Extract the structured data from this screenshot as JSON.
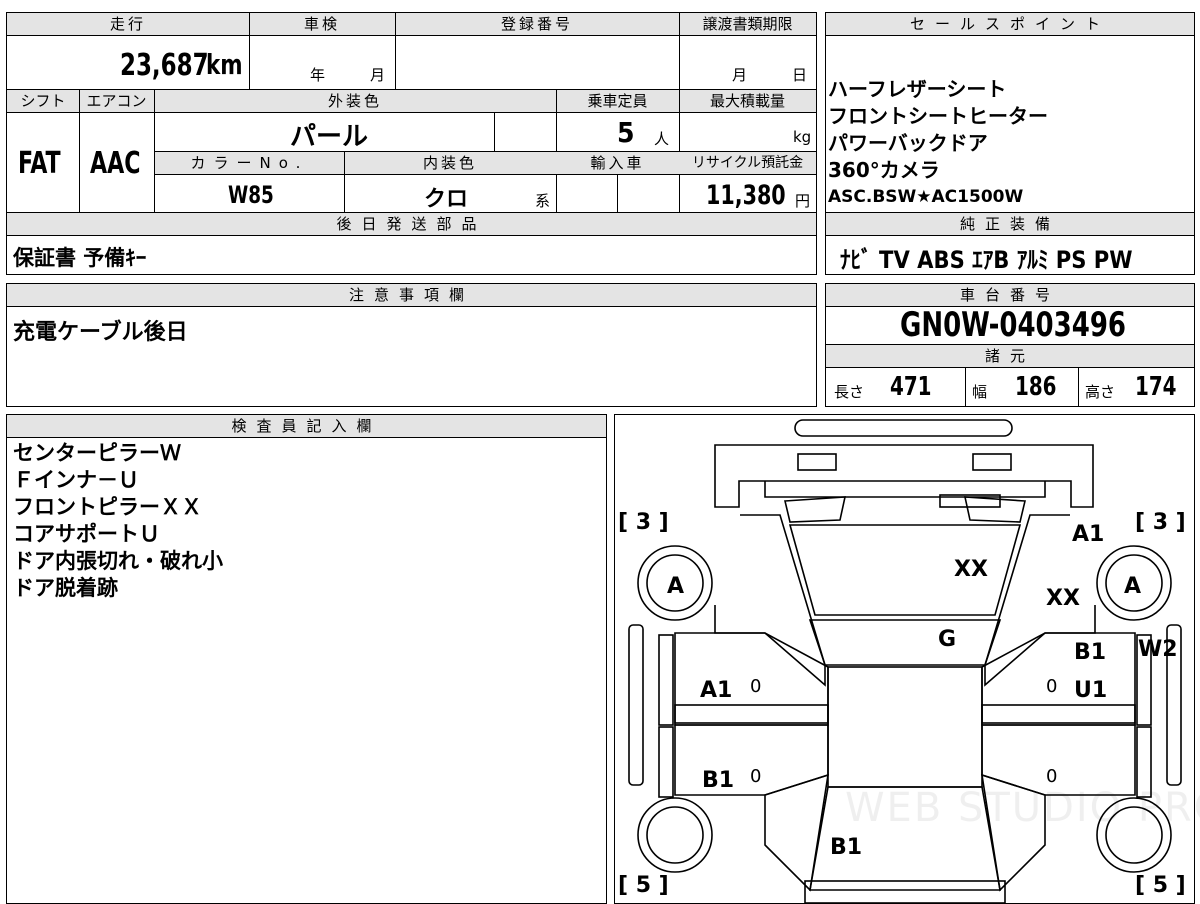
{
  "top": {
    "mileage_label": "走行",
    "mileage_value": "23,687",
    "mileage_unit": "km",
    "inspection_label": "車検",
    "inspection_year_unit": "年",
    "inspection_month_unit": "月",
    "registration_label": "登録番号",
    "transfer_label": "譲渡書類期限",
    "transfer_month_unit": "月",
    "transfer_day_unit": "日",
    "sales_points_label": "セールスポイント"
  },
  "specs": {
    "shift_label": "シフト",
    "shift_value": "FAT",
    "ac_label": "エアコン",
    "ac_value": "AAC",
    "exterior_color_label": "外装色",
    "exterior_color_value": "パール",
    "capacity_label": "乗車定員",
    "capacity_value": "5",
    "capacity_unit": "人",
    "max_load_label": "最大積載量",
    "max_load_unit": "kg",
    "color_no_label": "カラーNo.",
    "color_no_value": "W85",
    "interior_color_label": "内装色",
    "interior_color_value": "クロ",
    "interior_color_suffix": "系",
    "import_label": "輸入車",
    "recycle_label": "リサイクル預託金",
    "recycle_value": "11,380",
    "recycle_unit": "円"
  },
  "later_parts": {
    "label": "後日発送部品",
    "value": "保証書 予備ｷｰ"
  },
  "sales_points": {
    "items": [
      "ハーフレザーシート",
      "フロントシートヒーター",
      "パワーバックドア",
      "360°カメラ",
      "ASC.BSW★AC1500W"
    ]
  },
  "genuine_equipment": {
    "label": "純正装備",
    "value": "ﾅﾋﾞ TV ABS ｴｱB ｱﾙﾐ PS PW"
  },
  "notes": {
    "label": "注意事項欄",
    "value": "充電ケーブル後日"
  },
  "chassis": {
    "label": "車台番号",
    "value": "GN0W-0403496",
    "dims_label": "諸元",
    "length_label": "長さ",
    "length_value": "471",
    "width_label": "幅",
    "width_value": "186",
    "height_label": "高さ",
    "height_value": "174"
  },
  "inspector": {
    "label": "検査員記入欄",
    "items": [
      "センターピラーＷ",
      "Ｆインナ－Ｕ",
      "フロントピラーＸＸ",
      "コアサポートＵ",
      "ドア内張切れ・破れ小",
      "ドア脱着跡"
    ]
  },
  "diagram": {
    "tire_front_left": "[ 3 ]",
    "tire_front_right": "[ 3 ]",
    "tire_rear_left": "[ 5 ]",
    "tire_rear_right": "[ 5 ]",
    "wheel_fl": "A",
    "wheel_fr": "A",
    "marks": {
      "hood": "XX",
      "right_fender_a": "A1",
      "right_fender_xx": "XX",
      "windshield": "G",
      "left_front_door": "A1",
      "left_front_zero": "0",
      "left_rear_door": "B1",
      "left_rear_zero": "0",
      "right_front_door_b": "B1",
      "right_front_door_u": "U1",
      "right_front_zero": "0",
      "right_rear_zero": "0",
      "right_pillar": "W2",
      "rear": "B1"
    },
    "watermark": "WEB STUDIO PRO"
  }
}
